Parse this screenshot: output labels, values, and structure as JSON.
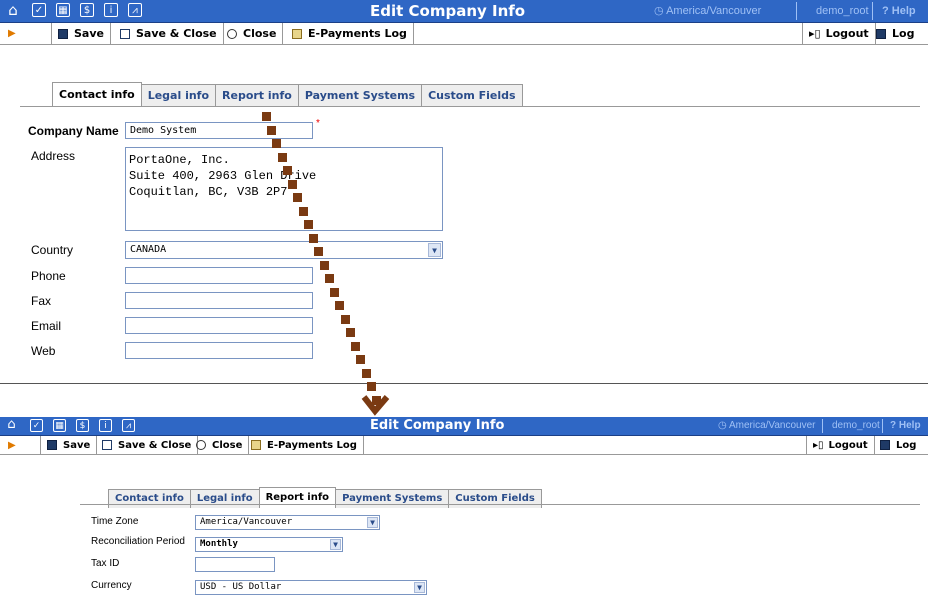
{
  "top": {
    "title": "Edit Company Info",
    "timezone": "America/Vancouver",
    "user": "demo_root",
    "help": "Help",
    "toolbar": {
      "save": "Save",
      "save_close": "Save & Close",
      "close": "Close",
      "epayments": "E-Payments Log",
      "logout": "Logout",
      "log": "Log"
    },
    "tabs": [
      "Contact info",
      "Legal info",
      "Report info",
      "Payment Systems",
      "Custom Fields"
    ],
    "active_tab": "Contact info",
    "fields": {
      "company_name_label": "Company Name",
      "company_name_value": "Demo System",
      "address_label": "Address",
      "address_value": "PortaOne, Inc.\nSuite 400, 2963 Glen Drive\nCoquitlan, BC, V3B 2P7",
      "country_label": "Country",
      "country_value": "CANADA",
      "phone_label": "Phone",
      "fax_label": "Fax",
      "email_label": "Email",
      "web_label": "Web"
    }
  },
  "bottom": {
    "title": "Edit Company Info",
    "timezone": "America/Vancouver",
    "user": "demo_root",
    "help": "Help",
    "toolbar": {
      "save": "Save",
      "save_close": "Save & Close",
      "close": "Close",
      "epayments": "E-Payments Log",
      "logout": "Logout",
      "log": "Log"
    },
    "tabs": [
      "Contact info",
      "Legal info",
      "Report info",
      "Payment Systems",
      "Custom Fields"
    ],
    "active_tab": "Report info",
    "fields": {
      "timezone_label": "Time Zone",
      "timezone_value": "America/Vancouver",
      "recon_label": "Reconciliation Period",
      "recon_value": "Monthly",
      "taxid_label": "Tax ID",
      "currency_label": "Currency",
      "currency_value": "USD - US Dollar"
    }
  },
  "colors": {
    "titlebar": "#2f67c5",
    "arrow": "#7a3a12",
    "required": "#e00000"
  }
}
